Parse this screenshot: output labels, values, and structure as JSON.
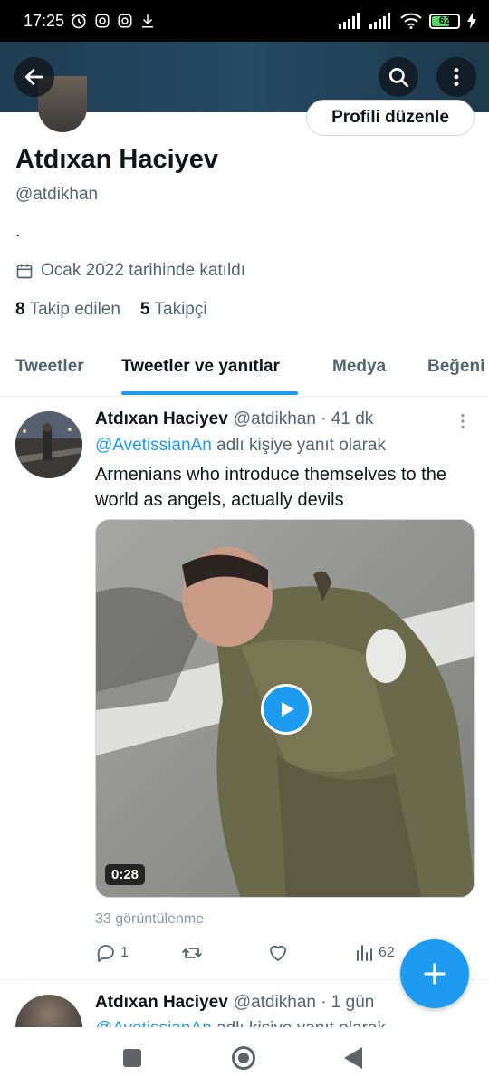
{
  "status_bar": {
    "time": "17:25",
    "battery": "62",
    "icons": [
      "alarm-icon",
      "instagram-icon",
      "instagram-icon",
      "download-icon",
      "signal-icon",
      "signal-icon",
      "wifi-icon",
      "charging-icon"
    ]
  },
  "header": {
    "back_icon": "arrow-left-icon",
    "search_icon": "search-icon",
    "more_icon": "more-vertical-icon",
    "edit_profile_label": "Profili düzenle"
  },
  "profile": {
    "name": "Atdıxan Haciyev",
    "handle": "@atdikhan",
    "bio": ".",
    "joined": "Ocak 2022 tarihinde katıldı",
    "following_count": "8",
    "following_label": "Takip edilen",
    "followers_count": "5",
    "followers_label": "Takipçi"
  },
  "tabs": [
    {
      "label": "Tweetler",
      "active": false
    },
    {
      "label": "Tweetler ve yanıtlar",
      "active": true
    },
    {
      "label": "Medya",
      "active": false
    },
    {
      "label": "Beğeni",
      "active": false
    }
  ],
  "tweets": [
    {
      "author": "Atdıxan Haciyev",
      "meta": "@atdikhan · 41 dk",
      "reply_to_link": "@AvetissianAn",
      "reply_to_text": "adlı kişiye yanıt olarak",
      "text": "Armenians who introduce themselves to the world as angels, actually devils",
      "video_duration": "0:28",
      "views": "33 görüntülenme",
      "replies": "1",
      "retweets": "",
      "likes": "",
      "impressions": "62"
    },
    {
      "author": "Atdıxan Haciyev",
      "meta": "@atdikhan · 1 gün",
      "reply_to_link": "@AvetissianAn",
      "reply_to_text": "adlı kişiye yanıt olarak"
    }
  ],
  "colors": {
    "accent": "#1d9bf0",
    "text": "#0f1419",
    "muted": "#536471"
  }
}
